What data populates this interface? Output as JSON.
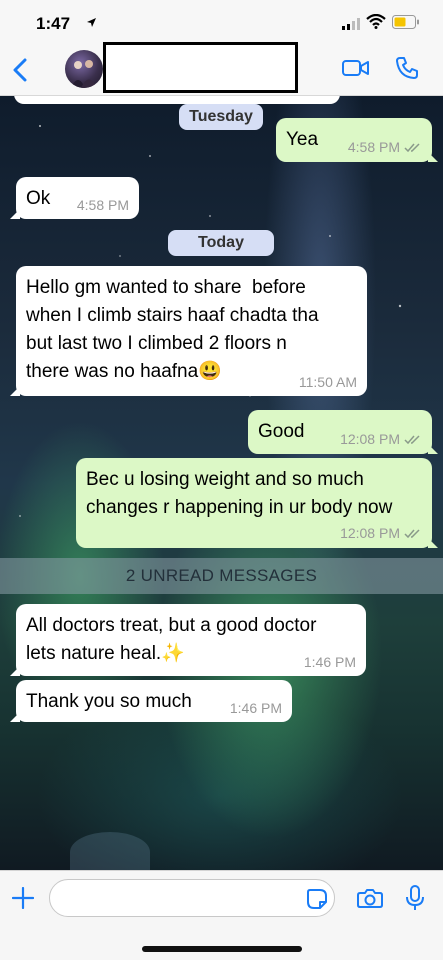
{
  "status_bar": {
    "time": "1:47"
  },
  "header": {
    "contact_name": ""
  },
  "date_separators": {
    "tuesday": "Tuesday",
    "today": "Today"
  },
  "unread_banner": "2 UNREAD MESSAGES",
  "messages": [
    {
      "direction": "out",
      "text": "Yea",
      "time": "4:58 PM",
      "read": true
    },
    {
      "direction": "in",
      "text": "Ok",
      "time": "4:58 PM"
    },
    {
      "direction": "in",
      "text": "Hello gm wanted to share  before\nwhen I climb stairs haaf chadta tha\nbut last two I climbed 2 floors n\nthere was no haafna😃",
      "time": "11:50 AM"
    },
    {
      "direction": "out",
      "text": "Good",
      "time": "12:08 PM",
      "read": true
    },
    {
      "direction": "out",
      "text": "Bec u losing weight and so much\nchanges r happening in ur body now",
      "time": "12:08 PM",
      "read": true
    },
    {
      "direction": "in",
      "text": "All doctors treat, but a good doctor\nlets nature heal.✨",
      "time": "1:46 PM"
    },
    {
      "direction": "in",
      "text": "Thank you so much",
      "time": "1:46 PM"
    }
  ],
  "input": {
    "value": "",
    "placeholder": ""
  },
  "colors": {
    "accent": "#1a7cf6",
    "outgoing_bubble": "#dcf8c6",
    "incoming_bubble": "#ffffff",
    "date_pill": "#d6def5"
  }
}
